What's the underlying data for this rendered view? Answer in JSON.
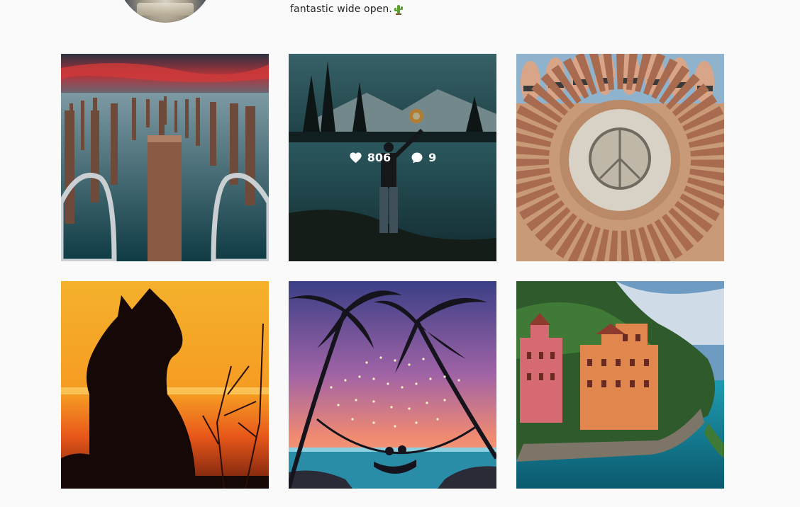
{
  "profile": {
    "bio_text": "fantastic wide open.",
    "bio_emoji": "cactus-icon"
  },
  "posts": [
    {
      "id": "pier-posts",
      "hovered": false
    },
    {
      "id": "torch-lake",
      "hovered": true,
      "likes": "806",
      "comments": "9"
    },
    {
      "id": "beach-circle",
      "hovered": false
    },
    {
      "id": "cat-sunset",
      "hovered": false
    },
    {
      "id": "hammock-palms",
      "hovered": false
    },
    {
      "id": "cliff-villa",
      "hovered": false
    }
  ],
  "icons": {
    "like": "heart-icon",
    "comment": "comment-bubble-icon"
  },
  "colors": {
    "background": "#fafafa",
    "text": "#262626",
    "overlay_text": "#ffffff"
  }
}
